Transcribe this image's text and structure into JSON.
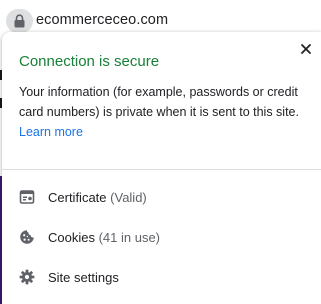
{
  "address_bar": {
    "url": "ecommerceceo.com",
    "lock_icon": "lock-icon"
  },
  "popup": {
    "title": "Connection is secure",
    "description": "Your information (for example, passwords or credit card numbers) is private when it is sent to this site.",
    "learn_more": "Learn more",
    "close_icon": "close-icon",
    "title_color": "#188038",
    "link_color": "#1a73e8",
    "items": [
      {
        "label": "Certificate",
        "detail": "(Valid)",
        "icon": "certificate-icon"
      },
      {
        "label": "Cookies",
        "detail": "(41 in use)",
        "icon": "cookie-icon"
      },
      {
        "label": "Site settings",
        "detail": "",
        "icon": "gear-icon"
      }
    ]
  }
}
